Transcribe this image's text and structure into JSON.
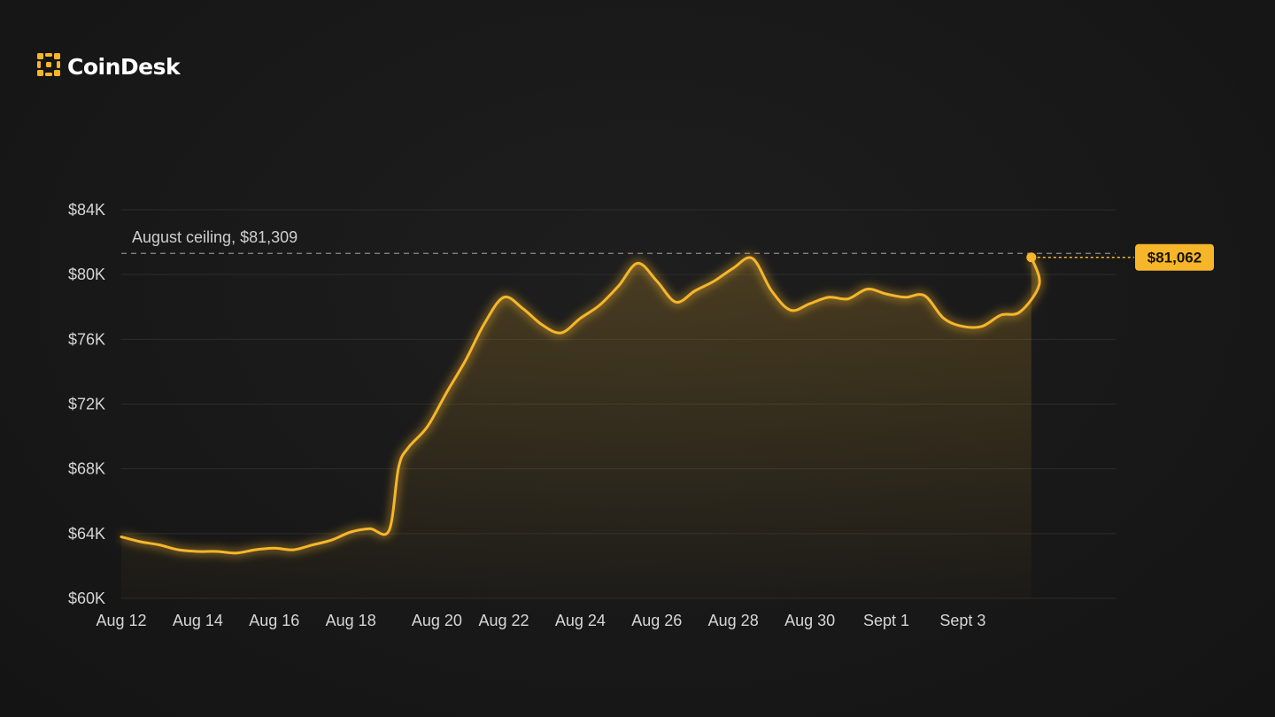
{
  "brand": {
    "name": "CoinDesk",
    "logo_icon": "coindesk-logo-icon",
    "accent": "#f7b62a"
  },
  "colors": {
    "background": "#181818",
    "line": "#f7b62a",
    "gridline": "#2c2c2c",
    "tick_text": "#d6d6d6"
  },
  "chart_data": {
    "type": "area",
    "title": "",
    "xlabel": "",
    "ylabel": "",
    "ylim": [
      60000,
      84000
    ],
    "y_ticks": [
      60000,
      64000,
      68000,
      72000,
      76000,
      80000,
      84000
    ],
    "y_tick_labels": [
      "$60K",
      "$64K",
      "$68K",
      "$72K",
      "$76K",
      "$80K",
      "$84K"
    ],
    "x_tick_labels": [
      {
        "date": "2024-08-12",
        "label": "Aug 12"
      },
      {
        "date": "2024-08-14",
        "label": "Aug 14"
      },
      {
        "date": "2024-08-16",
        "label": "Aug 16"
      },
      {
        "date": "2024-08-18",
        "label": "Aug 18"
      },
      {
        "date": "2024-08-20.25",
        "label": "Aug 20"
      },
      {
        "date": "2024-08-22",
        "label": "Aug 22"
      },
      {
        "date": "2024-08-24",
        "label": "Aug 24"
      },
      {
        "date": "2024-08-26",
        "label": "Aug 26"
      },
      {
        "date": "2024-08-28",
        "label": "Aug 28"
      },
      {
        "date": "2024-08-30",
        "label": "Aug 30"
      },
      {
        "date": "2024-09-01",
        "label": "Sept 1"
      },
      {
        "date": "2024-09-03",
        "label": "Sept 3"
      }
    ],
    "grid": true,
    "legend": "none",
    "series": [
      {
        "x": [
          "2024-08-12T00:00",
          "2024-08-12T12:00",
          "2024-08-13T00:00",
          "2024-08-13T12:00",
          "2024-08-14T00:00",
          "2024-08-14T12:00",
          "2024-08-15T00:00",
          "2024-08-15T12:00",
          "2024-08-16T00:00",
          "2024-08-16T12:00",
          "2024-08-17T00:00",
          "2024-08-17T12:00",
          "2024-08-18T00:00",
          "2024-08-18T12:00",
          "2024-08-19T00:00",
          "2024-08-19T06:00",
          "2024-08-19T12:00",
          "2024-08-20T00:00",
          "2024-08-20T12:00",
          "2024-08-21T00:00",
          "2024-08-21T12:00",
          "2024-08-22T00:00",
          "2024-08-22T12:00",
          "2024-08-23T00:00",
          "2024-08-23T12:00",
          "2024-08-24T00:00",
          "2024-08-24T12:00",
          "2024-08-25T00:00",
          "2024-08-25T12:00",
          "2024-08-26T00:00",
          "2024-08-26T12:00",
          "2024-08-27T00:00",
          "2024-08-27T12:00",
          "2024-08-28T00:00",
          "2024-08-28T12:00",
          "2024-08-29T00:00",
          "2024-08-29T12:00",
          "2024-08-30T00:00",
          "2024-08-30T12:00",
          "2024-08-31T00:00",
          "2024-08-31T12:00",
          "2024-09-01T00:00",
          "2024-09-01T12:00",
          "2024-09-02T00:00",
          "2024-09-02T12:00",
          "2024-09-03T00:00",
          "2024-09-03T12:00",
          "2024-09-04T00:00",
          "2024-09-04T12:00",
          "2024-09-05T00:00"
        ],
        "values": [
          63800,
          63500,
          63300,
          63000,
          62900,
          62900,
          62800,
          63000,
          63100,
          63000,
          63300,
          63600,
          64100,
          64300,
          64200,
          68100,
          69300,
          70600,
          72700,
          74700,
          77000,
          78600,
          77900,
          76900,
          76400,
          77300,
          78100,
          79300,
          80700,
          79600,
          78300,
          79000,
          79600,
          80400,
          81000,
          79000,
          77800,
          78200,
          78600,
          78500,
          79100,
          78800,
          78600,
          78700,
          77300,
          76800,
          76800,
          77500,
          77700,
          79400
        ]
      }
    ],
    "reference_line": {
      "value": 81309,
      "label": "August ceiling, $81,309"
    },
    "last_value": {
      "date": "2024-09-04T19:00",
      "value": 81062,
      "label": "$81,062"
    }
  }
}
